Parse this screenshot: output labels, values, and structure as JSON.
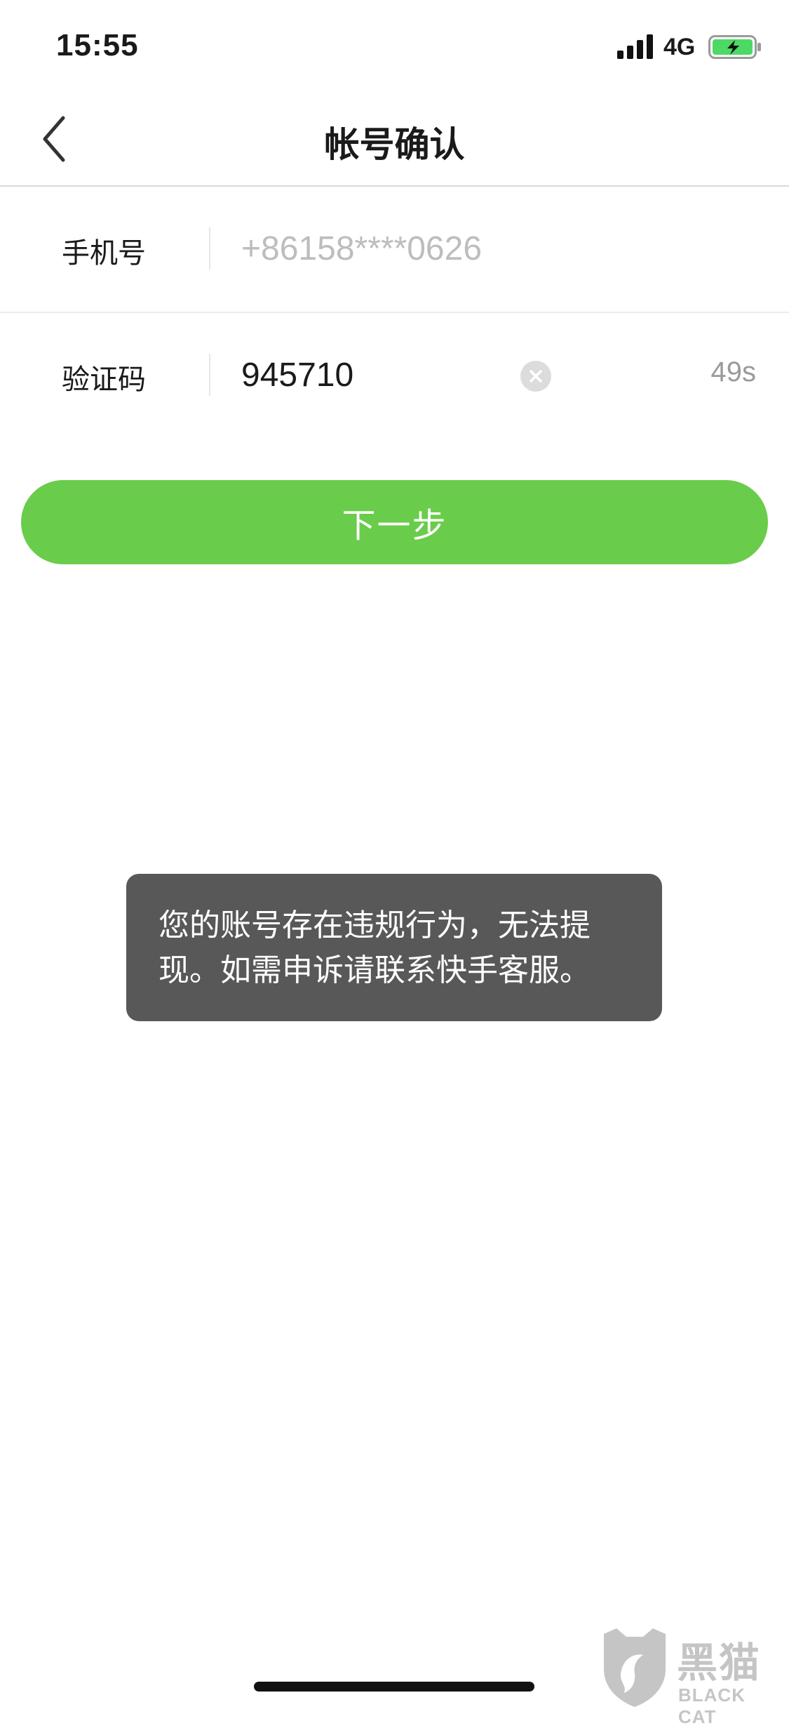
{
  "status_bar": {
    "time": "15:55",
    "network": "4G",
    "signal_icon": "signal-bars-icon",
    "battery_icon": "battery-charging-icon",
    "battery_color": "#4cd964"
  },
  "nav": {
    "title": "帐号确认",
    "back_icon": "chevron-left-icon"
  },
  "form": {
    "phone": {
      "label": "手机号",
      "placeholder": "+86158****0626"
    },
    "code": {
      "label": "验证码",
      "value": "945710",
      "clear_icon": "clear-circle-icon",
      "countdown": "49s"
    }
  },
  "next_button": {
    "label": "下一步",
    "color": "#6acc4b"
  },
  "toast": {
    "line1": "您的账号存在违规行为，无法提",
    "line2": "现。如需申诉请联系快手客服。"
  },
  "watermark": {
    "cn": "黑猫",
    "en": "BLACK CAT"
  }
}
